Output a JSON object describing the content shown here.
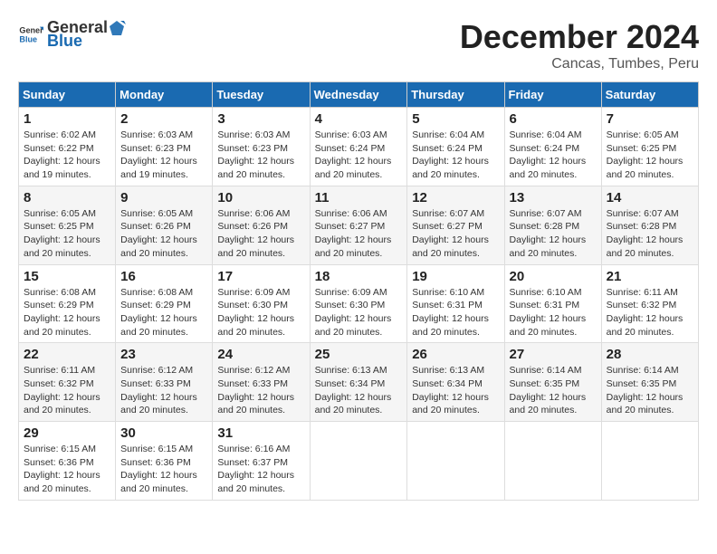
{
  "logo": {
    "general": "General",
    "blue": "Blue"
  },
  "header": {
    "month": "December 2024",
    "location": "Cancas, Tumbes, Peru"
  },
  "weekdays": [
    "Sunday",
    "Monday",
    "Tuesday",
    "Wednesday",
    "Thursday",
    "Friday",
    "Saturday"
  ],
  "weeks": [
    [
      {
        "day": "1",
        "info": "Sunrise: 6:02 AM\nSunset: 6:22 PM\nDaylight: 12 hours\nand 19 minutes."
      },
      {
        "day": "2",
        "info": "Sunrise: 6:03 AM\nSunset: 6:23 PM\nDaylight: 12 hours\nand 19 minutes."
      },
      {
        "day": "3",
        "info": "Sunrise: 6:03 AM\nSunset: 6:23 PM\nDaylight: 12 hours\nand 20 minutes."
      },
      {
        "day": "4",
        "info": "Sunrise: 6:03 AM\nSunset: 6:24 PM\nDaylight: 12 hours\nand 20 minutes."
      },
      {
        "day": "5",
        "info": "Sunrise: 6:04 AM\nSunset: 6:24 PM\nDaylight: 12 hours\nand 20 minutes."
      },
      {
        "day": "6",
        "info": "Sunrise: 6:04 AM\nSunset: 6:24 PM\nDaylight: 12 hours\nand 20 minutes."
      },
      {
        "day": "7",
        "info": "Sunrise: 6:05 AM\nSunset: 6:25 PM\nDaylight: 12 hours\nand 20 minutes."
      }
    ],
    [
      {
        "day": "8",
        "info": "Sunrise: 6:05 AM\nSunset: 6:25 PM\nDaylight: 12 hours\nand 20 minutes."
      },
      {
        "day": "9",
        "info": "Sunrise: 6:05 AM\nSunset: 6:26 PM\nDaylight: 12 hours\nand 20 minutes."
      },
      {
        "day": "10",
        "info": "Sunrise: 6:06 AM\nSunset: 6:26 PM\nDaylight: 12 hours\nand 20 minutes."
      },
      {
        "day": "11",
        "info": "Sunrise: 6:06 AM\nSunset: 6:27 PM\nDaylight: 12 hours\nand 20 minutes."
      },
      {
        "day": "12",
        "info": "Sunrise: 6:07 AM\nSunset: 6:27 PM\nDaylight: 12 hours\nand 20 minutes."
      },
      {
        "day": "13",
        "info": "Sunrise: 6:07 AM\nSunset: 6:28 PM\nDaylight: 12 hours\nand 20 minutes."
      },
      {
        "day": "14",
        "info": "Sunrise: 6:07 AM\nSunset: 6:28 PM\nDaylight: 12 hours\nand 20 minutes."
      }
    ],
    [
      {
        "day": "15",
        "info": "Sunrise: 6:08 AM\nSunset: 6:29 PM\nDaylight: 12 hours\nand 20 minutes."
      },
      {
        "day": "16",
        "info": "Sunrise: 6:08 AM\nSunset: 6:29 PM\nDaylight: 12 hours\nand 20 minutes."
      },
      {
        "day": "17",
        "info": "Sunrise: 6:09 AM\nSunset: 6:30 PM\nDaylight: 12 hours\nand 20 minutes."
      },
      {
        "day": "18",
        "info": "Sunrise: 6:09 AM\nSunset: 6:30 PM\nDaylight: 12 hours\nand 20 minutes."
      },
      {
        "day": "19",
        "info": "Sunrise: 6:10 AM\nSunset: 6:31 PM\nDaylight: 12 hours\nand 20 minutes."
      },
      {
        "day": "20",
        "info": "Sunrise: 6:10 AM\nSunset: 6:31 PM\nDaylight: 12 hours\nand 20 minutes."
      },
      {
        "day": "21",
        "info": "Sunrise: 6:11 AM\nSunset: 6:32 PM\nDaylight: 12 hours\nand 20 minutes."
      }
    ],
    [
      {
        "day": "22",
        "info": "Sunrise: 6:11 AM\nSunset: 6:32 PM\nDaylight: 12 hours\nand 20 minutes."
      },
      {
        "day": "23",
        "info": "Sunrise: 6:12 AM\nSunset: 6:33 PM\nDaylight: 12 hours\nand 20 minutes."
      },
      {
        "day": "24",
        "info": "Sunrise: 6:12 AM\nSunset: 6:33 PM\nDaylight: 12 hours\nand 20 minutes."
      },
      {
        "day": "25",
        "info": "Sunrise: 6:13 AM\nSunset: 6:34 PM\nDaylight: 12 hours\nand 20 minutes."
      },
      {
        "day": "26",
        "info": "Sunrise: 6:13 AM\nSunset: 6:34 PM\nDaylight: 12 hours\nand 20 minutes."
      },
      {
        "day": "27",
        "info": "Sunrise: 6:14 AM\nSunset: 6:35 PM\nDaylight: 12 hours\nand 20 minutes."
      },
      {
        "day": "28",
        "info": "Sunrise: 6:14 AM\nSunset: 6:35 PM\nDaylight: 12 hours\nand 20 minutes."
      }
    ],
    [
      {
        "day": "29",
        "info": "Sunrise: 6:15 AM\nSunset: 6:36 PM\nDaylight: 12 hours\nand 20 minutes."
      },
      {
        "day": "30",
        "info": "Sunrise: 6:15 AM\nSunset: 6:36 PM\nDaylight: 12 hours\nand 20 minutes."
      },
      {
        "day": "31",
        "info": "Sunrise: 6:16 AM\nSunset: 6:37 PM\nDaylight: 12 hours\nand 20 minutes."
      },
      {
        "day": "",
        "info": ""
      },
      {
        "day": "",
        "info": ""
      },
      {
        "day": "",
        "info": ""
      },
      {
        "day": "",
        "info": ""
      }
    ]
  ]
}
